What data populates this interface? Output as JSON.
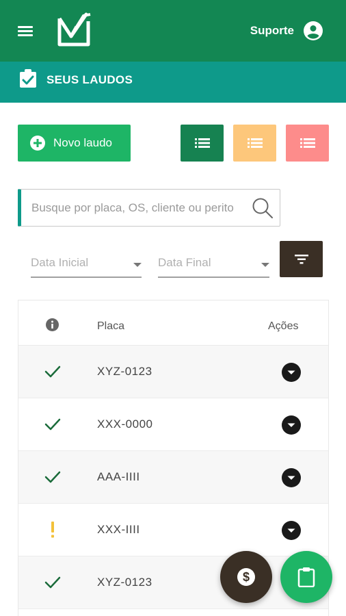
{
  "header": {
    "support_label": "Suporte",
    "brand_color": "#138753",
    "icons": {
      "menu": "menu-icon",
      "logo": "logo",
      "account": "account-circle-icon"
    }
  },
  "subheader": {
    "title": "SEUS LAUDOS",
    "color": "#0e9a8a",
    "icon": "clipboard-check-icon"
  },
  "toolbar": {
    "new_report_label": "Novo laudo",
    "view_buttons": [
      {
        "name": "list-view-all",
        "color": "#168251"
      },
      {
        "name": "list-view-pending",
        "color": "#fdc77b"
      },
      {
        "name": "list-view-rejected",
        "color": "#fd8c8b"
      }
    ]
  },
  "search": {
    "placeholder": "Busque por placa, OS, cliente ou perito",
    "value": ""
  },
  "filters": {
    "start_date_placeholder": "Data Inicial",
    "end_date_placeholder": "Data Final",
    "filter_button_icon": "filter-icon"
  },
  "table": {
    "columns": {
      "info_icon": "info-icon",
      "plate": "Placa",
      "actions": "Ações"
    },
    "rows": [
      {
        "status": "ok",
        "plate": "XYZ-0123"
      },
      {
        "status": "ok",
        "plate": "XXX-0000"
      },
      {
        "status": "ok",
        "plate": "AAA-IIII"
      },
      {
        "status": "pending",
        "plate": "XXX-IIII"
      },
      {
        "status": "ok",
        "plate": "XYZ-0123"
      }
    ]
  },
  "fabs": [
    {
      "name": "payments",
      "icon": "dollar-icon",
      "color": "#3a2f25"
    },
    {
      "name": "new-report",
      "icon": "clipboard-icon",
      "color": "#1eb566"
    }
  ]
}
